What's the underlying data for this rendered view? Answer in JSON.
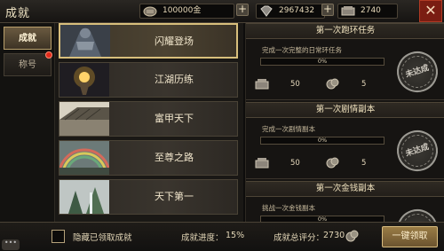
{
  "header": {
    "title": "成就"
  },
  "resources": {
    "gold": {
      "value": "100000金",
      "icon": "gold-coin-icon"
    },
    "diamond": {
      "value": "2967432",
      "icon": "diamond-icon"
    },
    "bound_diamond": {
      "value": "2740",
      "icon": "bound-diamond-icon"
    }
  },
  "tabs": [
    {
      "label": "成就",
      "active": true
    },
    {
      "label": "称号",
      "active": false,
      "badge": true
    }
  ],
  "achievements": [
    {
      "label": "闪耀登场",
      "selected": true
    },
    {
      "label": "江湖历练",
      "selected": false
    },
    {
      "label": "富甲天下",
      "selected": false
    },
    {
      "label": "至尊之路",
      "selected": false
    },
    {
      "label": "天下第一",
      "selected": false
    }
  ],
  "tasks": [
    {
      "title": "第一次跑环任务",
      "desc": "完成一次完整的日常环任务",
      "progress": "0%",
      "progress_value": 0,
      "rewards": [
        {
          "icon": "bound-diamond-icon",
          "value": "50"
        },
        {
          "icon": "token-icon",
          "value": "5"
        }
      ],
      "status": "未达成"
    },
    {
      "title": "第一次剧情副本",
      "desc": "完成一次剧情副本",
      "progress": "0%",
      "progress_value": 0,
      "rewards": [
        {
          "icon": "bound-diamond-icon",
          "value": "50"
        },
        {
          "icon": "token-icon",
          "value": "5"
        }
      ],
      "status": "未达成"
    },
    {
      "title": "第一次金钱副本",
      "desc": "挑战一次金钱副本",
      "progress": "0%",
      "progress_value": 0,
      "rewards": [],
      "status": ""
    }
  ],
  "footer": {
    "hide_claimed_label": "隐藏已领取成就",
    "progress_label": "成就进度：",
    "progress_value": "15%",
    "score_label": "成就总评分：",
    "score_value": "2730",
    "claim_all": "一键领取"
  },
  "colors": {
    "accent": "#d8bf7c",
    "close": "#7a1d12",
    "badge": "#e12a1c",
    "progress_fill": "#b58a3c"
  }
}
